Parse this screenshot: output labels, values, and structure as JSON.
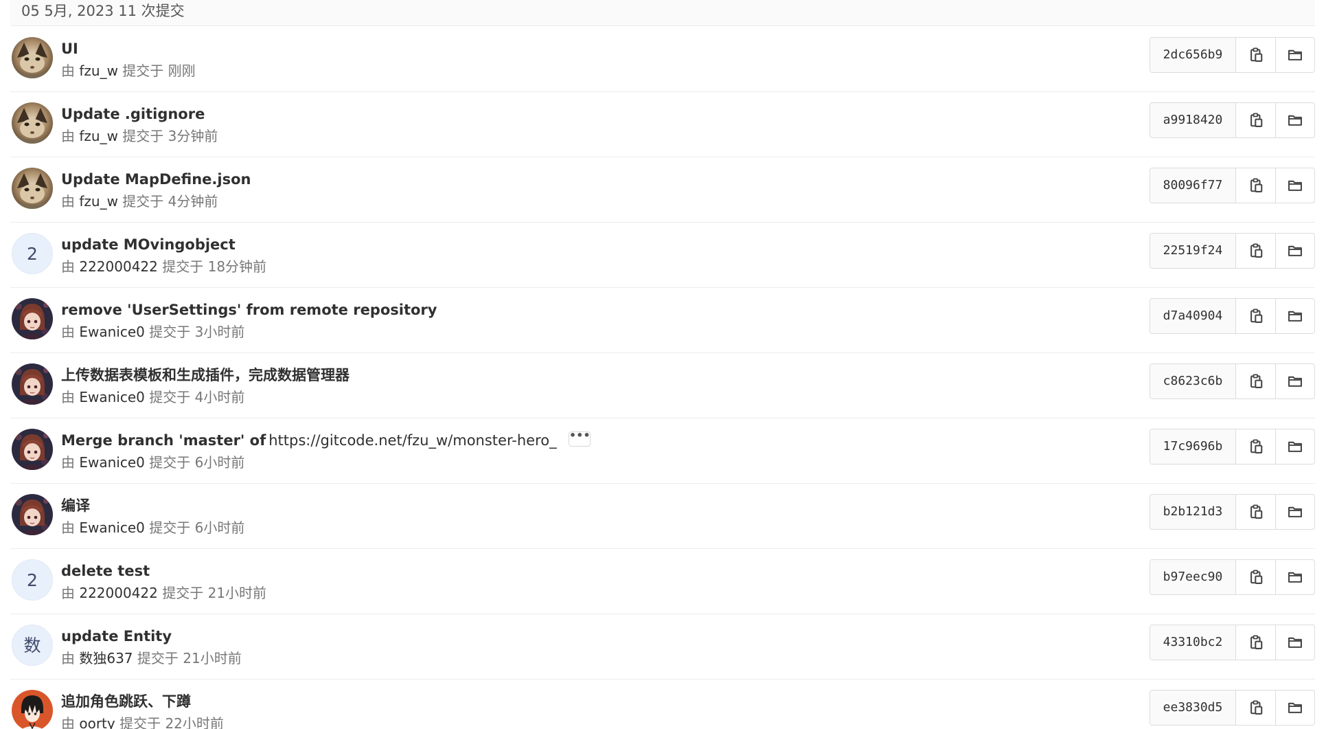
{
  "day_header": "05 5月, 2023 11 次提交",
  "by_prefix": "由",
  "committed_word": "提交于",
  "commits": [
    {
      "title": "UI",
      "author": "fzu_w",
      "time": "刚刚",
      "sha": "2dc656b9",
      "avatar": "cat"
    },
    {
      "title": "Update .gitignore",
      "author": "fzu_w",
      "time": "3分钟前",
      "sha": "a9918420",
      "avatar": "cat"
    },
    {
      "title": "Update MapDefine.json",
      "author": "fzu_w",
      "time": "4分钟前",
      "sha": "80096f77",
      "avatar": "cat"
    },
    {
      "title": "update MOvingobject",
      "author": "222000422",
      "time": "18分钟前",
      "sha": "22519f24",
      "avatar": "initial",
      "initial": "2"
    },
    {
      "title": "remove 'UserSettings' from remote repository",
      "author": "Ewanice0",
      "time": "3小时前",
      "sha": "d7a40904",
      "avatar": "anime"
    },
    {
      "title": "上传数据表模板和生成插件，完成数据管理器",
      "author": "Ewanice0",
      "time": "4小时前",
      "sha": "c8623c6b",
      "avatar": "anime"
    },
    {
      "title": "Merge branch 'master' of",
      "title_link": "https://gitcode.net/fzu_w/monster-hero_",
      "has_ellipsis": true,
      "ellipsis": "•••",
      "author": "Ewanice0",
      "time": "6小时前",
      "sha": "17c9696b",
      "avatar": "anime"
    },
    {
      "title": "编译",
      "author": "Ewanice0",
      "time": "6小时前",
      "sha": "b2b121d3",
      "avatar": "anime"
    },
    {
      "title": "delete test",
      "author": "222000422",
      "time": "21小时前",
      "sha": "b97eec90",
      "avatar": "initial",
      "initial": "2"
    },
    {
      "title": "update Entity",
      "author": "数独637",
      "time": "21小时前",
      "sha": "43310bc2",
      "avatar": "initial",
      "initial": "数"
    },
    {
      "title": "追加角色跳跃、下蹲",
      "author": "oorty",
      "time": "22小时前",
      "sha": "ee3830d5",
      "avatar": "boy"
    }
  ],
  "icons": {
    "copy": "clipboard-icon",
    "browse": "folder-icon"
  },
  "colors": {
    "header_bg": "#fafafa",
    "border": "#dcdcdc",
    "initial_avatar_bg": "#e8f0fc"
  }
}
